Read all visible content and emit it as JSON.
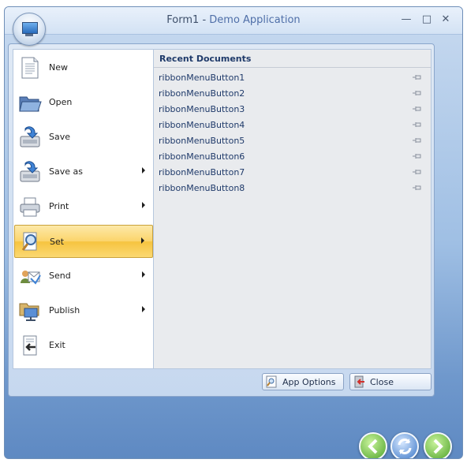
{
  "window": {
    "title_prefix": "Form1 - ",
    "title_app": "Demo Application",
    "minimize_glyph": "—",
    "maximize_glyph": "□",
    "close_glyph": "✕",
    "orb_icon": "computer-monitor-icon"
  },
  "menu": {
    "items": [
      {
        "label": "New",
        "icon": "new-document-icon",
        "has_submenu": false
      },
      {
        "label": "Open",
        "icon": "open-folder-icon",
        "has_submenu": false
      },
      {
        "label": "Save",
        "icon": "save-icon",
        "has_submenu": false
      },
      {
        "label": "Save as",
        "icon": "save-as-icon",
        "has_submenu": true
      },
      {
        "label": "Print",
        "icon": "printer-icon",
        "has_submenu": true
      },
      {
        "label": "Set",
        "icon": "settings-magnifier-icon",
        "has_submenu": true,
        "highlighted": true
      },
      {
        "label": "Send",
        "icon": "send-people-icon",
        "has_submenu": true
      },
      {
        "label": "Publish",
        "icon": "publish-network-icon",
        "has_submenu": true
      },
      {
        "label": "Exit",
        "icon": "exit-icon",
        "has_submenu": false
      }
    ],
    "highlight_color": "#fbd46a"
  },
  "recent": {
    "title": "Recent Documents",
    "items": [
      "ribbonMenuButton1",
      "ribbonMenuButton2",
      "ribbonMenuButton3",
      "ribbonMenuButton4",
      "ribbonMenuButton5",
      "ribbonMenuButton6",
      "ribbonMenuButton7",
      "ribbonMenuButton8"
    ],
    "pin_icon": "pin-icon"
  },
  "footer": {
    "options_label": "App Options",
    "close_label": "Close"
  },
  "nav": {
    "back_icon": "back-arrow-icon",
    "refresh_icon": "refresh-icon",
    "forward_icon": "forward-arrow-icon"
  }
}
